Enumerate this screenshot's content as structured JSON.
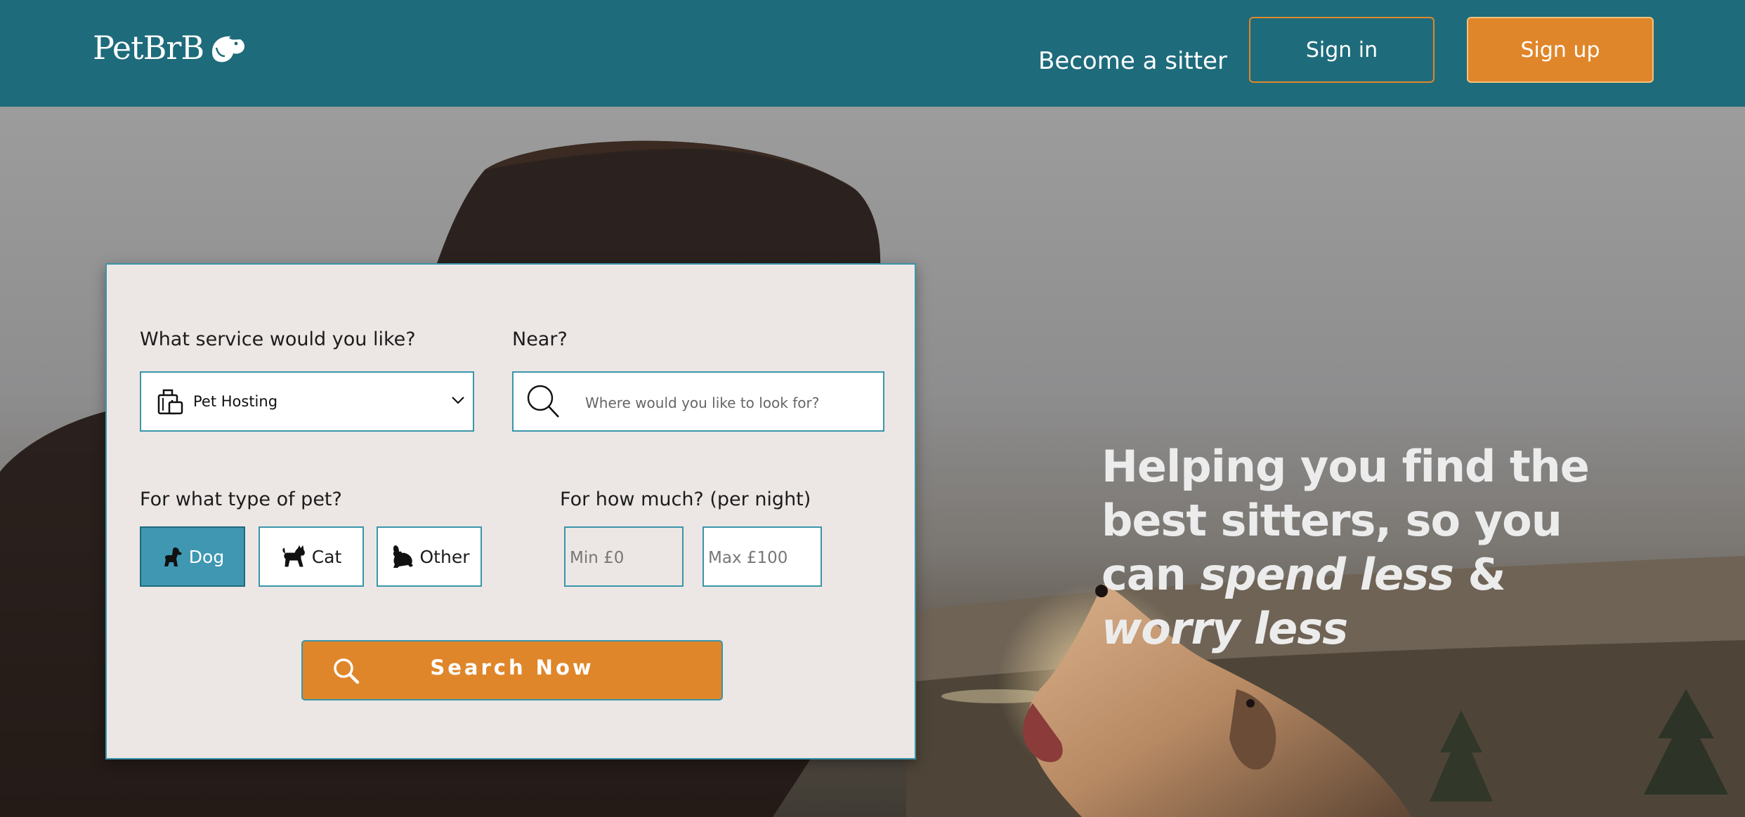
{
  "header": {
    "logo_text": "PetBrB",
    "become_sitter": "Become a sitter",
    "sign_in": "Sign in",
    "sign_up": "Sign up",
    "colors": {
      "bar": "#1e6b7b",
      "accent": "#e0862a"
    }
  },
  "search": {
    "service_label": "What service would you like?",
    "service_value": "Pet Hosting",
    "service_icon": "luggage-icon",
    "near_label": "Near?",
    "near_placeholder": "Where would you like to look for?",
    "pet_label": "For what type of pet?",
    "pets": [
      {
        "label": "Dog",
        "icon": "dog-icon",
        "selected": true
      },
      {
        "label": "Cat",
        "icon": "cat-icon",
        "selected": false
      },
      {
        "label": "Other",
        "icon": "rabbit-icon",
        "selected": false
      }
    ],
    "price_label": "For how much? (per night)",
    "min_placeholder": "Min £0",
    "max_placeholder": "Max £100",
    "submit": "Search Now"
  },
  "hero": {
    "line_1": "Helping you find the",
    "line_2": "best sitters, so you",
    "line_3_prefix": "can",
    "line_3_em": "spend less",
    "line_3_suffix": "&",
    "line_4_em": "worry less"
  }
}
